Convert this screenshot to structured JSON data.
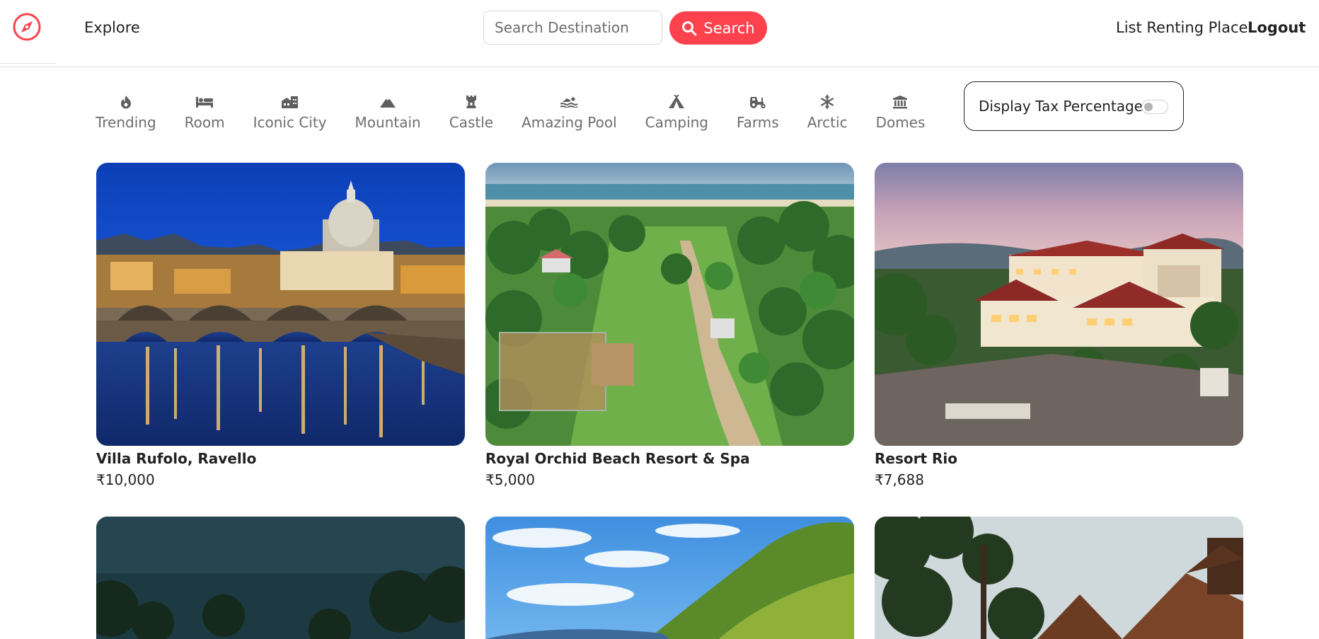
{
  "nav": {
    "explore": "Explore",
    "search_placeholder": "Search Destination",
    "search_button": "Search",
    "list_place": "List Renting Place",
    "logout": "Logout"
  },
  "filters": [
    {
      "label": "Trending",
      "icon": "fire-icon"
    },
    {
      "label": "Room",
      "icon": "bed-icon"
    },
    {
      "label": "Iconic City",
      "icon": "city-icon"
    },
    {
      "label": "Mountain",
      "icon": "mountain-icon"
    },
    {
      "label": "Castle",
      "icon": "castle-icon"
    },
    {
      "label": "Amazing Pool",
      "icon": "swimmer-icon"
    },
    {
      "label": "Camping",
      "icon": "tent-icon"
    },
    {
      "label": "Farms",
      "icon": "tractor-icon"
    },
    {
      "label": "Arctic",
      "icon": "snowflake-icon"
    },
    {
      "label": "Domes",
      "icon": "dome-icon"
    }
  ],
  "tax_toggle": {
    "label": "Display Tax Percentage",
    "enabled": false
  },
  "listings": [
    {
      "title": "Villa Rufolo, Ravello",
      "price": "₹10,000"
    },
    {
      "title": "Royal Orchid Beach Resort & Spa",
      "price": "₹5,000"
    },
    {
      "title": "Resort Rio",
      "price": "₹7,688"
    }
  ],
  "colors": {
    "accent": "#fe424d",
    "text": "#222222",
    "muted": "#6e6e6e",
    "border": "#e4e4e4"
  }
}
